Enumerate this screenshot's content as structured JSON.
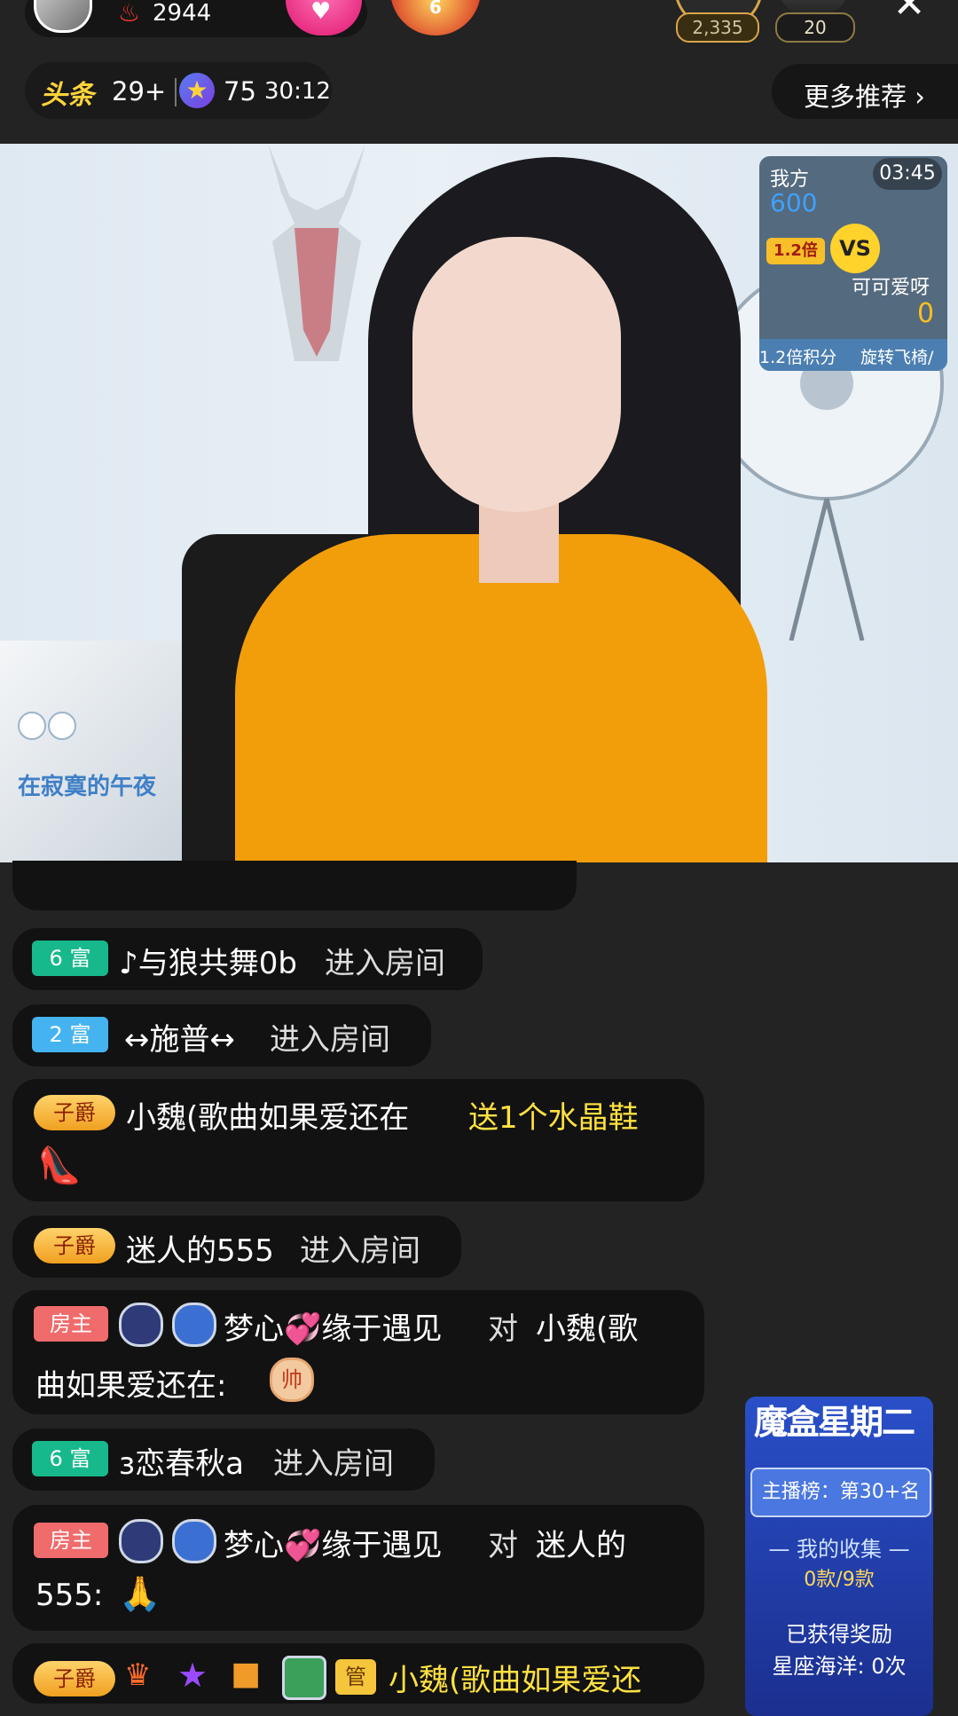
{
  "header": {
    "heat": "2944",
    "badge_level": "6",
    "viewer_a_count": "2,335",
    "viewer_b_count": "20",
    "close_glyph": "✕"
  },
  "rank_bar": {
    "logo_text": "头条",
    "rank": "29+",
    "star_count": "75",
    "timer": "30:12"
  },
  "more_button": {
    "label": "更多推荐 ›"
  },
  "pip": {
    "title": "在寂寞的午夜"
  },
  "pk": {
    "me_label": "我方",
    "me_score": "600",
    "countdown": "03:45",
    "multiplier": "1.2倍",
    "vs": "VS",
    "opponent": "可可爱呀",
    "opponent_score": "0",
    "bar_left": "1.2倍积分",
    "bar_right": "旋转飞椅/"
  },
  "chat": [
    {
      "badge": "6 富",
      "user": "♪与狼共舞0b",
      "text": "进入房间"
    },
    {
      "badge": "2 富",
      "user": "↔施普↔",
      "text": "进入房间"
    },
    {
      "badge": "子爵",
      "user": "小魏(歌曲如果爱还在",
      "gift": "送1个水晶鞋",
      "gift_icon": "👠"
    },
    {
      "badge": "子爵",
      "user": "迷人的555",
      "text": "进入房间"
    },
    {
      "badge": "房主",
      "user": "梦心💞缘于遇见",
      "to_word": "对",
      "target": "小魏(歌",
      "line2": "曲如果爱还在:",
      "emoji": "帅"
    },
    {
      "badge": "6 富",
      "user": "ɜ恋春秋a",
      "text": "进入房间"
    },
    {
      "badge": "房主",
      "user": "梦心💞缘于遇见",
      "to_word": "对",
      "target": "迷人的",
      "line2": "555:",
      "emoji": "🙏"
    },
    {
      "badge": "子爵",
      "extra_badge": "管",
      "user": "小魏(歌曲如果爱还"
    }
  ],
  "promo": {
    "title": "魔盒星期二",
    "rank": "主播榜：第30+名",
    "collect_label": "— 我的收集 —",
    "collect_value": "0款/9款",
    "reward_label": "已获得奖励",
    "reward_value": "星座海洋: 0次"
  }
}
